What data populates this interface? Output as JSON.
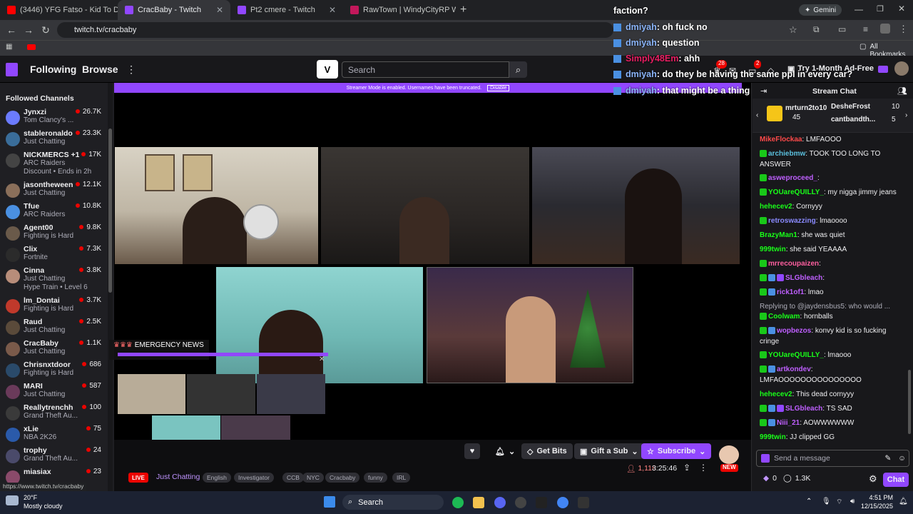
{
  "browser": {
    "tabs": [
      {
        "label": "(3446) YFG Fatso - Kid To D_",
        "favicon_color": "#ff0000"
      },
      {
        "label": "CracBaby - Twitch",
        "favicon_color": "#9147ff"
      },
      {
        "label": "Pt2 cmere - Twitch",
        "favicon_color": "#9147ff"
      },
      {
        "label": "RawTown | WindyCityRP Wiki | F",
        "favicon_color": "#c2185b"
      }
    ],
    "new_tab_label": "+",
    "url": "twitch.tv/cracbaby",
    "all_bookmarks": "All Bookmarks",
    "gemini_label": "Gemini",
    "status_url": "https://www.twitch.tv/cracbaby"
  },
  "twitch_nav": {
    "following": "Following",
    "browse": "Browse",
    "search_placeholder": "Search",
    "ad_free": "Try 1-Month Ad-Free",
    "notif_count_1": "28",
    "notif_count_2": "2"
  },
  "sidebar": {
    "header": "Followed Channels",
    "channels": [
      {
        "name": "Jynxzi",
        "game": "Tom Clancy's ...",
        "viewers": "26.7K",
        "color": "#6b7bff"
      },
      {
        "name": "stableronaldo",
        "game": "Just Chatting",
        "viewers": "23.3K",
        "color": "#3a6d9a"
      },
      {
        "name": "NICKMERCS +1",
        "game": "ARC Raiders",
        "viewers": "17K",
        "extra": "Discount • Ends in 2h",
        "color": "#444"
      },
      {
        "name": "jasontheween",
        "game": "Just Chatting",
        "viewers": "12.1K",
        "color": "#8a6f5a"
      },
      {
        "name": "Tfue",
        "game": "ARC Raiders",
        "viewers": "10.8K",
        "color": "#4a90e2"
      },
      {
        "name": "Agent00",
        "game": "Fighting is Hard",
        "viewers": "9.8K",
        "color": "#6a5a4a"
      },
      {
        "name": "Clix",
        "game": "Fortnite",
        "viewers": "7.3K",
        "color": "#2b2b2b"
      },
      {
        "name": "Cinna",
        "game": "Just Chatting",
        "viewers": "3.8K",
        "extra": "Hype Train • Level 6",
        "color": "#b88d7a"
      },
      {
        "name": "lm_Dontai",
        "game": "Fighting is Hard",
        "viewers": "3.7K",
        "color": "#c0392b"
      },
      {
        "name": "Raud",
        "game": "Just Chatting",
        "viewers": "2.5K",
        "color": "#5a4a3a"
      },
      {
        "name": "CracBaby",
        "game": "Just Chatting",
        "viewers": "1.1K",
        "color": "#7a5a4a"
      },
      {
        "name": "Chrisnxtdoor",
        "game": "Fighting is Hard",
        "viewers": "686",
        "color": "#2a4a6a"
      },
      {
        "name": "MARI",
        "game": "Just Chatting",
        "viewers": "587",
        "color": "#6a3a5a"
      },
      {
        "name": "Reallytrenchh",
        "game": "Grand Theft Au...",
        "viewers": "100",
        "color": "#3a3a3a"
      },
      {
        "name": "xLie",
        "game": "NBA 2K26",
        "viewers": "75",
        "color": "#2a5aaa"
      },
      {
        "name": "trophy",
        "game": "Grand Theft Au...",
        "viewers": "24",
        "color": "#4a4a6a"
      },
      {
        "name": "miasiax",
        "game": "",
        "viewers": "23",
        "color": "#8a4a6a"
      }
    ]
  },
  "stream": {
    "banner_text": "Streamer Mode is enabled. Usernames have been truncated.",
    "banner_button": "Disable",
    "emergency_label": "EMERGENCY NEWS",
    "live_badge": "LIVE",
    "category": "Just Chatting",
    "tags": [
      "English",
      "Investigator",
      "CCB",
      "NYC",
      "Cracbaby",
      "funny",
      "IRL"
    ],
    "viewer_count": "1,118",
    "uptime": "3:25:46",
    "get_bits": "Get Bits",
    "gift_sub": "Gift a Sub",
    "subscribe": "Subscribe",
    "new_badge": "NEW"
  },
  "overlay_chat": [
    {
      "user": "",
      "text": "faction?",
      "color": "#ffffff"
    },
    {
      "user": "dmiyah",
      "text": ": oh fuck no",
      "color": "#8ab4f8"
    },
    {
      "user": "dmiyah",
      "text": ": question",
      "color": "#8ab4f8"
    },
    {
      "user": "Simply48Em",
      "text": ": ahh",
      "color": "#e91e63"
    },
    {
      "user": "dmiyah",
      "text": ": do they be having the same ppl in every car?",
      "color": "#8ab4f8"
    },
    {
      "user": "dmiyah",
      "text": ": that might be a thing too",
      "color": "#8ab4f8"
    }
  ],
  "chat": {
    "title": "Stream Chat",
    "gift_top": {
      "user": "mrturn2to10",
      "count": "45"
    },
    "gift_right": [
      {
        "user": "DesheFrost",
        "count": "10"
      },
      {
        "user": "cantbandth...",
        "count": "5"
      }
    ],
    "messages": [
      {
        "user": "MikeFlockaa",
        "text": ": LMFAOOO",
        "color": "#ff4a4a",
        "badges": 0
      },
      {
        "user": "archiebmw",
        "text": ": TOOK TOO LONG TO ANSWER",
        "color": "#5bc0de",
        "badges": 1
      },
      {
        "user": "asweproceed_",
        "text": ":",
        "color": "#bf5fff",
        "badges": 1
      },
      {
        "user": "YOUareQUILLY_",
        "text": ": my nigga jimmy jeans",
        "color": "#19ff19",
        "badges": 1
      },
      {
        "user": "hehecev2",
        "text": ": Cornyyy",
        "color": "#19ff19",
        "badges": 0
      },
      {
        "user": "retroswazzing",
        "text": ": lmaoooo",
        "color": "#8a8aff",
        "badges": 1
      },
      {
        "user": "BrazyMan1",
        "text": ": she was quiet",
        "color": "#19ff19",
        "badges": 0
      },
      {
        "user": "999twin",
        "text": ": she said YEAAAA",
        "color": "#19ff19",
        "badges": 0
      },
      {
        "user": "mrrecoupaizen",
        "text": ":",
        "color": "#ff5f9f",
        "badges": 1
      },
      {
        "user": "SLGbleach",
        "text": ":",
        "color": "#bf5fff",
        "badges": 3
      },
      {
        "user": "rick1of1",
        "text": ": lmao",
        "color": "#bf5fff",
        "badges": 2
      },
      {
        "user": "",
        "text": "Replying to @jaydensbus5: who would ...",
        "color": "#adadb8",
        "badges": 0
      },
      {
        "user": "Coolwam",
        "text": ": hornballs",
        "color": "#19ff19",
        "badges": 1
      },
      {
        "user": "wopbezos",
        "text": ": konvy kid is so fucking cringe",
        "color": "#bf5fff",
        "badges": 2
      },
      {
        "user": "YOUareQUILLY_",
        "text": ": lmaooo",
        "color": "#19ff19",
        "badges": 1
      },
      {
        "user": "artkondev",
        "text": ": LMFAOOOOOOOOOOOOOOO",
        "color": "#bf5fff",
        "badges": 2
      },
      {
        "user": "hehecev2",
        "text": ": This dead cornyyy",
        "color": "#19ff19",
        "badges": 0
      },
      {
        "user": "SLGbleach",
        "text": ": TS SAD",
        "color": "#bf5fff",
        "badges": 3
      },
      {
        "user": "Niii_21",
        "text": ": AOWWWWWW",
        "color": "#bf5fff",
        "badges": 2
      },
      {
        "user": "999twin",
        "text": ": JJ clipped GG",
        "color": "#19ff19",
        "badges": 0
      }
    ],
    "input_placeholder": "Send a message",
    "bits": "0",
    "points": "1.3K",
    "chat_button": "Chat"
  },
  "taskbar": {
    "weather_temp": "20°F",
    "weather_desc": "Mostly cloudy",
    "search": "Search",
    "time": "4:51 PM",
    "date": "12/15/2025"
  },
  "colors": {
    "twitch_purple": "#9147ff",
    "live_red": "#eb0400"
  }
}
